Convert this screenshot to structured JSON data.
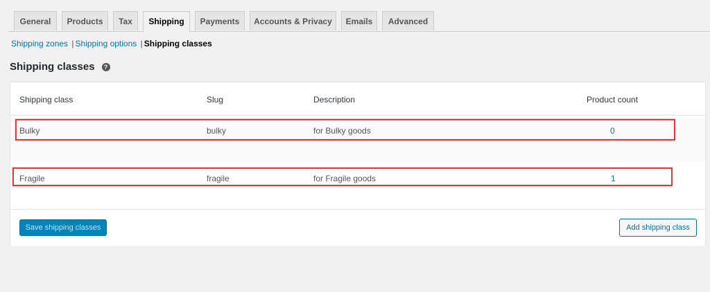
{
  "tabs": [
    {
      "label": "General",
      "active": false
    },
    {
      "label": "Products",
      "active": false
    },
    {
      "label": "Tax",
      "active": false
    },
    {
      "label": "Shipping",
      "active": true
    },
    {
      "label": "Payments",
      "active": false
    },
    {
      "label": "Accounts & Privacy",
      "active": false
    },
    {
      "label": "Emails",
      "active": false
    },
    {
      "label": "Advanced",
      "active": false
    }
  ],
  "subnav": {
    "items": [
      "Shipping zones",
      "Shipping options",
      "Shipping classes"
    ],
    "separator": "|",
    "current_index": 2
  },
  "heading": {
    "title": "Shipping classes",
    "help_icon": "?"
  },
  "table": {
    "columns": [
      "Shipping class",
      "Slug",
      "Description",
      "Product count"
    ],
    "rows": [
      {
        "name": "Bulky",
        "slug": "bulky",
        "description": "for Bulky goods",
        "count": "0"
      },
      {
        "name": "Fragile",
        "slug": "fragile",
        "description": "for Fragile goods",
        "count": "1"
      }
    ]
  },
  "footer": {
    "save_label": "Save shipping classes",
    "add_label": "Add shipping class"
  },
  "colors": {
    "accent": "#0073aa",
    "primary_button": "#0085ba",
    "highlight_border": "#e03a3a"
  }
}
